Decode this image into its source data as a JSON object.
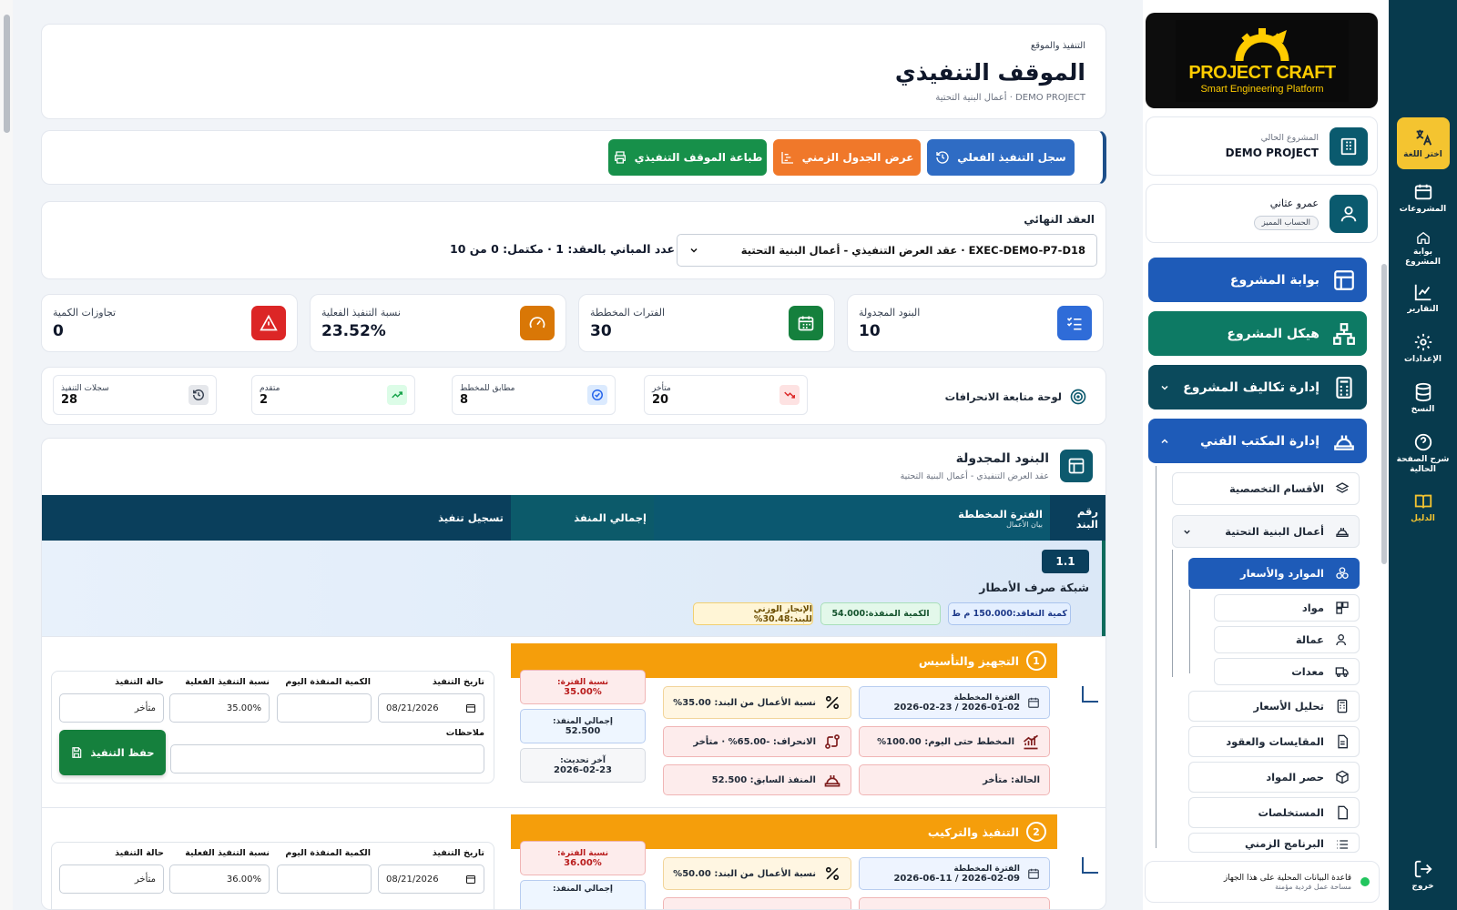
{
  "rail": {
    "items": [
      {
        "label": "اختر اللغة",
        "icon": "translate-icon"
      },
      {
        "label": "المشروعات",
        "icon": "calendar-icon"
      },
      {
        "label": "بوابة المشروع",
        "icon": "home-icon"
      },
      {
        "label": "التقارير",
        "icon": "chart-icon"
      },
      {
        "label": "الإعدادات",
        "icon": "gear-icon"
      },
      {
        "label": "النسخ",
        "icon": "database-icon"
      },
      {
        "label": "شرح الصفحة الحالية",
        "icon": "help-icon"
      },
      {
        "label": "الدليل",
        "icon": "book-icon"
      }
    ],
    "logout": "خروج"
  },
  "sidebar": {
    "logo": {
      "line1": "PROJECT CRAFT",
      "line2": "Smart Engineering Platform"
    },
    "current_project": {
      "label": "المشروع الحالي",
      "name": "DEMO PROJECT"
    },
    "user": {
      "name": "عمرو عثاني",
      "badge": "الحساب المميز"
    },
    "nav": {
      "portal": "بوابة المشروع",
      "structure": "هيكل المشروع",
      "costs": "إدارة تكاليف المشروع",
      "tech_office": "إدارة المكتب الفني",
      "divisions": "الأقسام التخصصية",
      "infra": "أعمال البنية التحتية",
      "resources": "الموارد والأسعار",
      "materials": "مواد",
      "labor": "عمالة",
      "equipment": "معدات",
      "price_analysis": "تحليل الأسعار",
      "contracts": "المقايسات والعقود",
      "takeoff": "حصر المواد",
      "invoices": "المستخلصات",
      "schedule": "البرنامج الزمني"
    },
    "db_note": {
      "title": "قاعدة البيانات المحلية على هذا الجهاز",
      "sub": "مساحة عمل فردية مؤمنة"
    }
  },
  "header": {
    "breadcrumb": "التنفيذ والموقع",
    "title": "الموقف التنفيذي",
    "subtitle": "DEMO PROJECT · أعمال البنية التحتية"
  },
  "actions": {
    "log": "سجل التنفيذ الفعلي",
    "timeline": "عرض الجدول الزمني",
    "print": "طباعة الموقف التنفيذي"
  },
  "contract": {
    "label": "العقد النهائي",
    "selected": "EXEC-DEMO-P7-D18 · عقد العرض التنفيذي - أعمال البنية التحتية",
    "summary": "عدد المباني بالعقد: 1 · مكتمل: 0 من 10"
  },
  "kpis": [
    {
      "label": "البنود المجدولة",
      "value": "10",
      "color": "#2563eb"
    },
    {
      "label": "الفترات المخططة",
      "value": "30",
      "color": "#15803d"
    },
    {
      "label": "نسبة التنفيذ الفعلية",
      "value": "23.52%",
      "color": "#d97706"
    },
    {
      "label": "تجاوزات الكمية",
      "value": "0",
      "color": "#dc2626"
    }
  ],
  "deviation": {
    "title": "لوحة متابعة الانحرافات",
    "cards": [
      {
        "label": "متأخر",
        "value": "20"
      },
      {
        "label": "مطابق للمخطط",
        "value": "8"
      },
      {
        "label": "متقدم",
        "value": "2"
      },
      {
        "label": "سجلات التنفيذ",
        "value": "28"
      }
    ]
  },
  "schedule": {
    "title": "البنود المجدولة",
    "subtitle": "عقد العرض التنفيذي - أعمال البنية التحتية",
    "columns": {
      "item_no": "رقم البند",
      "period": "الفترة المخططة",
      "period_sub": "بيان الأعمال",
      "total": "إجمالي المنفذ",
      "record": "تسجيل تنفيذ"
    },
    "item": {
      "code": "1.1",
      "name": "شبكة صرف الأمطار",
      "contract_qty": "كمية التعاقد:150.000 م ط",
      "executed_qty": "الكمية المنفذة:54.000",
      "weighted": "الإنجاز الوزني للبند:30.48%"
    },
    "phases": [
      {
        "num": "1",
        "name": "التجهيز والتأسيس",
        "period_label": "الفترة المخططة",
        "period": "2026-01-02 / 2026-02-23",
        "planned": "المخطط حتى اليوم: 100.00%",
        "status": "الحالة: متأخر",
        "work_pct": "نسبة الأعمال من البند: 35.00%",
        "deviation": "الانحراف: -65.00% · متأخر",
        "prev": "المنفذ السابق: 52.500",
        "period_pct_label": "نسبة الفترة:",
        "period_pct": "35.00%",
        "total_label": "إجمالي المنفذ:",
        "total": "52.500",
        "last_label": "آخر تحديث:",
        "last": "2026-02-23",
        "form": {
          "date_label": "تاريخ التنفيذ",
          "date": "08/21/2026",
          "qty_label": "الكمية المنفذة اليوم",
          "qty": "",
          "pct_label": "نسبة التنفيذ الفعلية",
          "pct": "35.00%",
          "state_label": "حالة التنفيذ",
          "state": "متأخر",
          "notes_label": "ملاحظات",
          "save": "حفظ التنفيذ"
        }
      },
      {
        "num": "2",
        "name": "التنفيذ والتركيب",
        "period_label": "الفترة المخططة",
        "period": "2026-02-09 / 2026-06-11",
        "work_pct": "نسبة الأعمال من البند: 50.00%",
        "period_pct_label": "نسبة الفترة:",
        "period_pct": "36.00%",
        "total_label": "إجمالي المنفذ:",
        "form": {
          "date_label": "تاريخ التنفيذ",
          "date": "08/21/2026",
          "qty_label": "الكمية المنفذة اليوم",
          "pct_label": "نسبة التنفيذ الفعلية",
          "pct": "36.00%",
          "state_label": "حالة التنفيذ",
          "state": "متأخر"
        }
      }
    ]
  }
}
